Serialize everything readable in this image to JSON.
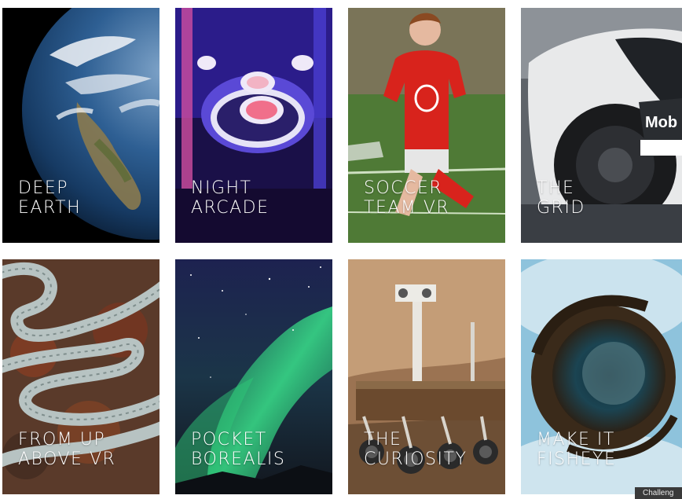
{
  "cards": [
    {
      "line1": "DEEP",
      "line2": "EARTH"
    },
    {
      "line1": "NIGHT",
      "line2": "ARCADE"
    },
    {
      "line1": "SOCCER",
      "line2": "TEAM VR"
    },
    {
      "line1": "THE",
      "line2": "GRID"
    },
    {
      "line1": "FROM UP",
      "line2": "ABOVE VR"
    },
    {
      "line1": "POCKET",
      "line2": "BOREALIS"
    },
    {
      "line1": "THE",
      "line2": "CURIOSITY"
    },
    {
      "line1": "MAKE IT",
      "line2": "FISHEYE"
    }
  ],
  "badge": {
    "text": "Challeng"
  },
  "images": {
    "card1": "earth-from-space",
    "card2": "skee-ball-arcade",
    "card3": "soccer-player",
    "card4": "race-car",
    "card5": "winding-road-aerial",
    "card6": "aurora-borealis",
    "card7": "mars-rover",
    "card8": "fisheye-planet"
  }
}
